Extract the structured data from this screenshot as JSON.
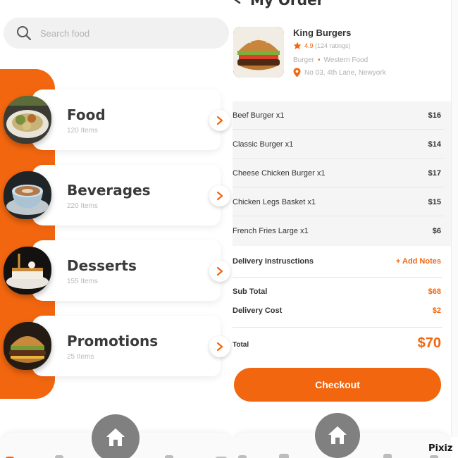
{
  "search": {
    "placeholder": "Search food"
  },
  "categories": [
    {
      "title": "Food",
      "count": "120 Items",
      "image": "food-plate"
    },
    {
      "title": "Beverages",
      "count": "220 Items",
      "image": "coffee-cup"
    },
    {
      "title": "Desserts",
      "count": "155 Items",
      "image": "dessert-plate"
    },
    {
      "title": "Promotions",
      "count": "25 Items",
      "image": "burger"
    }
  ],
  "order": {
    "title": "My Order",
    "restaurant": {
      "name": "King Burgers",
      "rating": "4.9",
      "ratings_count": "(124 ratings)",
      "type": "Burger",
      "cuisine": "Western Food",
      "address": "No 03, 4th Lane, Newyork"
    },
    "items": [
      {
        "name": "Beef Burger x1",
        "price": "$16"
      },
      {
        "name": "Classic Burger x1",
        "price": "$14"
      },
      {
        "name": "Cheese Chicken Burger x1",
        "price": "$17"
      },
      {
        "name": "Chicken Legs Basket x1",
        "price": "$15"
      },
      {
        "name": "French Fries Large x1",
        "price": "$6"
      }
    ],
    "delivery_instructions_label": "Delivery Instruscti​ons",
    "add_notes_label": "+ Add Notes",
    "subtotal_label": "Sub Total",
    "subtotal_value": "$68",
    "delivery_cost_label": "Delivery Cost",
    "delivery_cost_value": "$2",
    "total_label": "Total",
    "total_value": "$70",
    "checkout_label": "Checkout"
  },
  "watermark": "Pixiz",
  "colors": {
    "accent": "#f2660f",
    "nav_home": "#808080"
  }
}
